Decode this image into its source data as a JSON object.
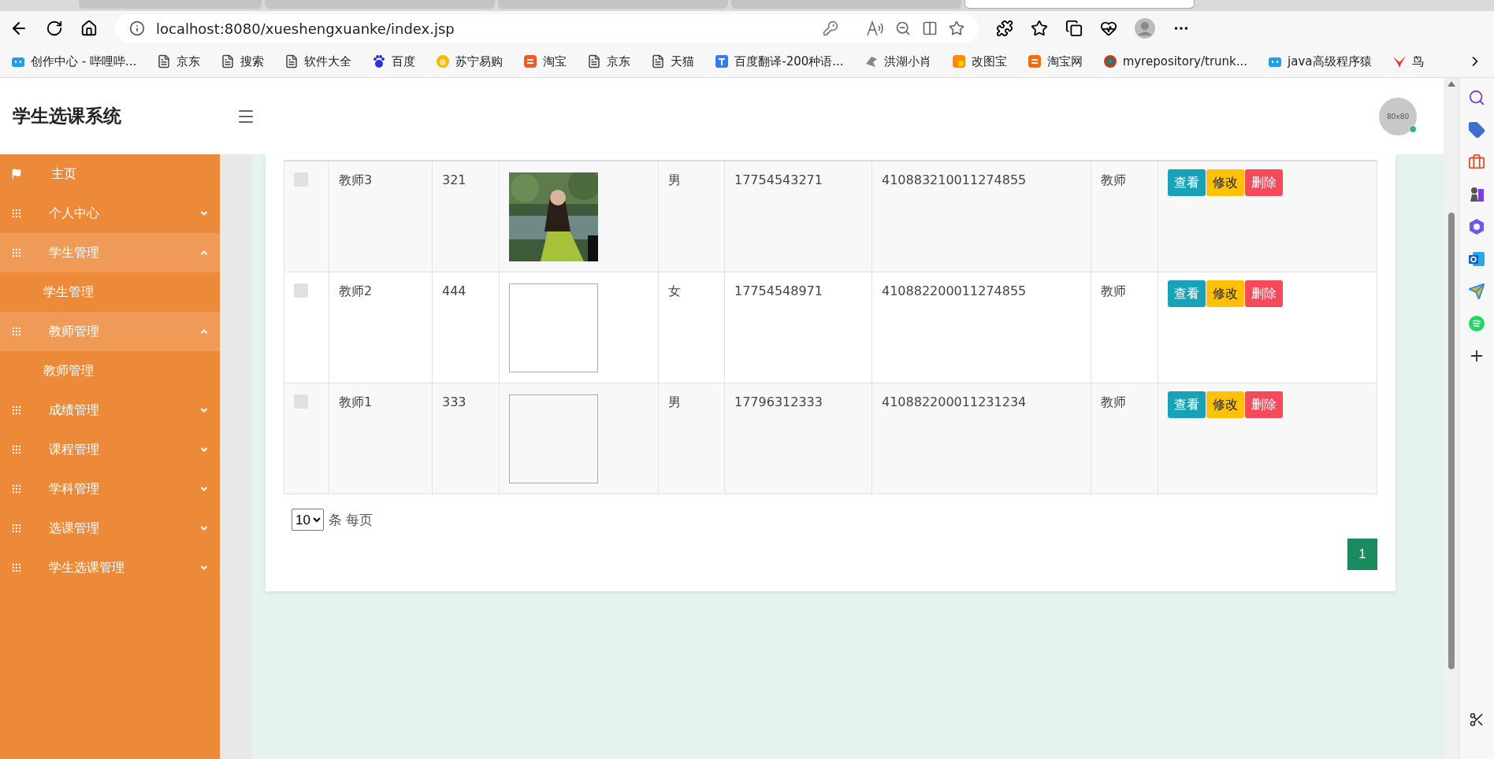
{
  "browser": {
    "tabs": [
      {
        "selected": false
      },
      {
        "selected": false
      },
      {
        "selected": false
      },
      {
        "selected": false
      },
      {
        "selected": true
      }
    ],
    "address": "localhost:8080/xueshengxuanke/index.jsp",
    "bookmarks": [
      {
        "label": "创作中心 - 哔哩哔...",
        "kind": "tv",
        "color": "#20a0e0"
      },
      {
        "label": "京东",
        "kind": "page",
        "color": "#444444"
      },
      {
        "label": "搜索",
        "kind": "page",
        "color": "#444444"
      },
      {
        "label": "软件大全",
        "kind": "page",
        "color": "#444444"
      },
      {
        "label": "百度",
        "kind": "paw",
        "color": "#2932e1"
      },
      {
        "label": "苏宁易购",
        "kind": "lion",
        "color": "#f5b800"
      },
      {
        "label": "淘宝",
        "kind": "tao",
        "color": "#f05a24"
      },
      {
        "label": "京东",
        "kind": "page",
        "color": "#444444"
      },
      {
        "label": "天猫",
        "kind": "page",
        "color": "#444444"
      },
      {
        "label": "百度翻译-200种语...",
        "kind": "yi",
        "color": "#2f7cf6"
      },
      {
        "label": "洪湖小肖",
        "kind": "bird",
        "color": "#888888"
      },
      {
        "label": "改图宝",
        "kind": "square",
        "color": "#ff8a00"
      },
      {
        "label": "淘宝网",
        "kind": "tao",
        "color": "#ff6a00"
      },
      {
        "label": "myrepository/trunk...",
        "kind": "globe",
        "color": "#c0392b"
      },
      {
        "label": "java高级程序猿",
        "kind": "tv",
        "color": "#20a0e0"
      },
      {
        "label": "鸟",
        "kind": "bird2",
        "color": "#e03a2e"
      }
    ]
  },
  "header": {
    "title": "学生选课系统",
    "avatar": "80x80"
  },
  "sidebar": [
    {
      "label": "主页",
      "kind": "home"
    },
    {
      "label": "个人中心",
      "kind": "menu",
      "expanded": false
    },
    {
      "label": "学生管理",
      "kind": "menu",
      "expanded": true,
      "children": [
        {
          "label": "学生管理"
        }
      ]
    },
    {
      "label": "教师管理",
      "kind": "menu",
      "expanded": true,
      "children": [
        {
          "label": "教师管理"
        }
      ]
    },
    {
      "label": "成绩管理",
      "kind": "menu",
      "expanded": false
    },
    {
      "label": "课程管理",
      "kind": "menu",
      "expanded": false
    },
    {
      "label": "学科管理",
      "kind": "menu",
      "expanded": false
    },
    {
      "label": "选课管理",
      "kind": "menu",
      "expanded": false
    },
    {
      "label": "学生选课管理",
      "kind": "menu",
      "expanded": false
    }
  ],
  "table": {
    "rows": [
      {
        "checked": false,
        "name": "教师3",
        "number": "321",
        "gender": "男",
        "phone": "17754543271",
        "id_card": "410883210011274855",
        "role": "教师",
        "actions": [
          "查看",
          "修改",
          "删除"
        ]
      },
      {
        "checked": false,
        "name": "教师2",
        "number": "444",
        "photo": {
          "kind": "broken"
        },
        "gender": "女",
        "phone": "17754548971",
        "id_card": "410882200011274855",
        "role": "教师",
        "actions": [
          "查看",
          "修改",
          "删除"
        ]
      },
      {
        "checked": false,
        "name": "教师1",
        "number": "333",
        "photo": {
          "kind": "broken"
        },
        "gender": "男",
        "phone": "17796312333",
        "id_card": "410882200011231234",
        "role": "教师",
        "actions": [
          "查看",
          "修改",
          "删除"
        ]
      }
    ]
  },
  "pagination": {
    "page_size": "10",
    "page_size_label": "条 每页",
    "pages": [
      {
        "label": "1",
        "selected": true
      }
    ]
  }
}
